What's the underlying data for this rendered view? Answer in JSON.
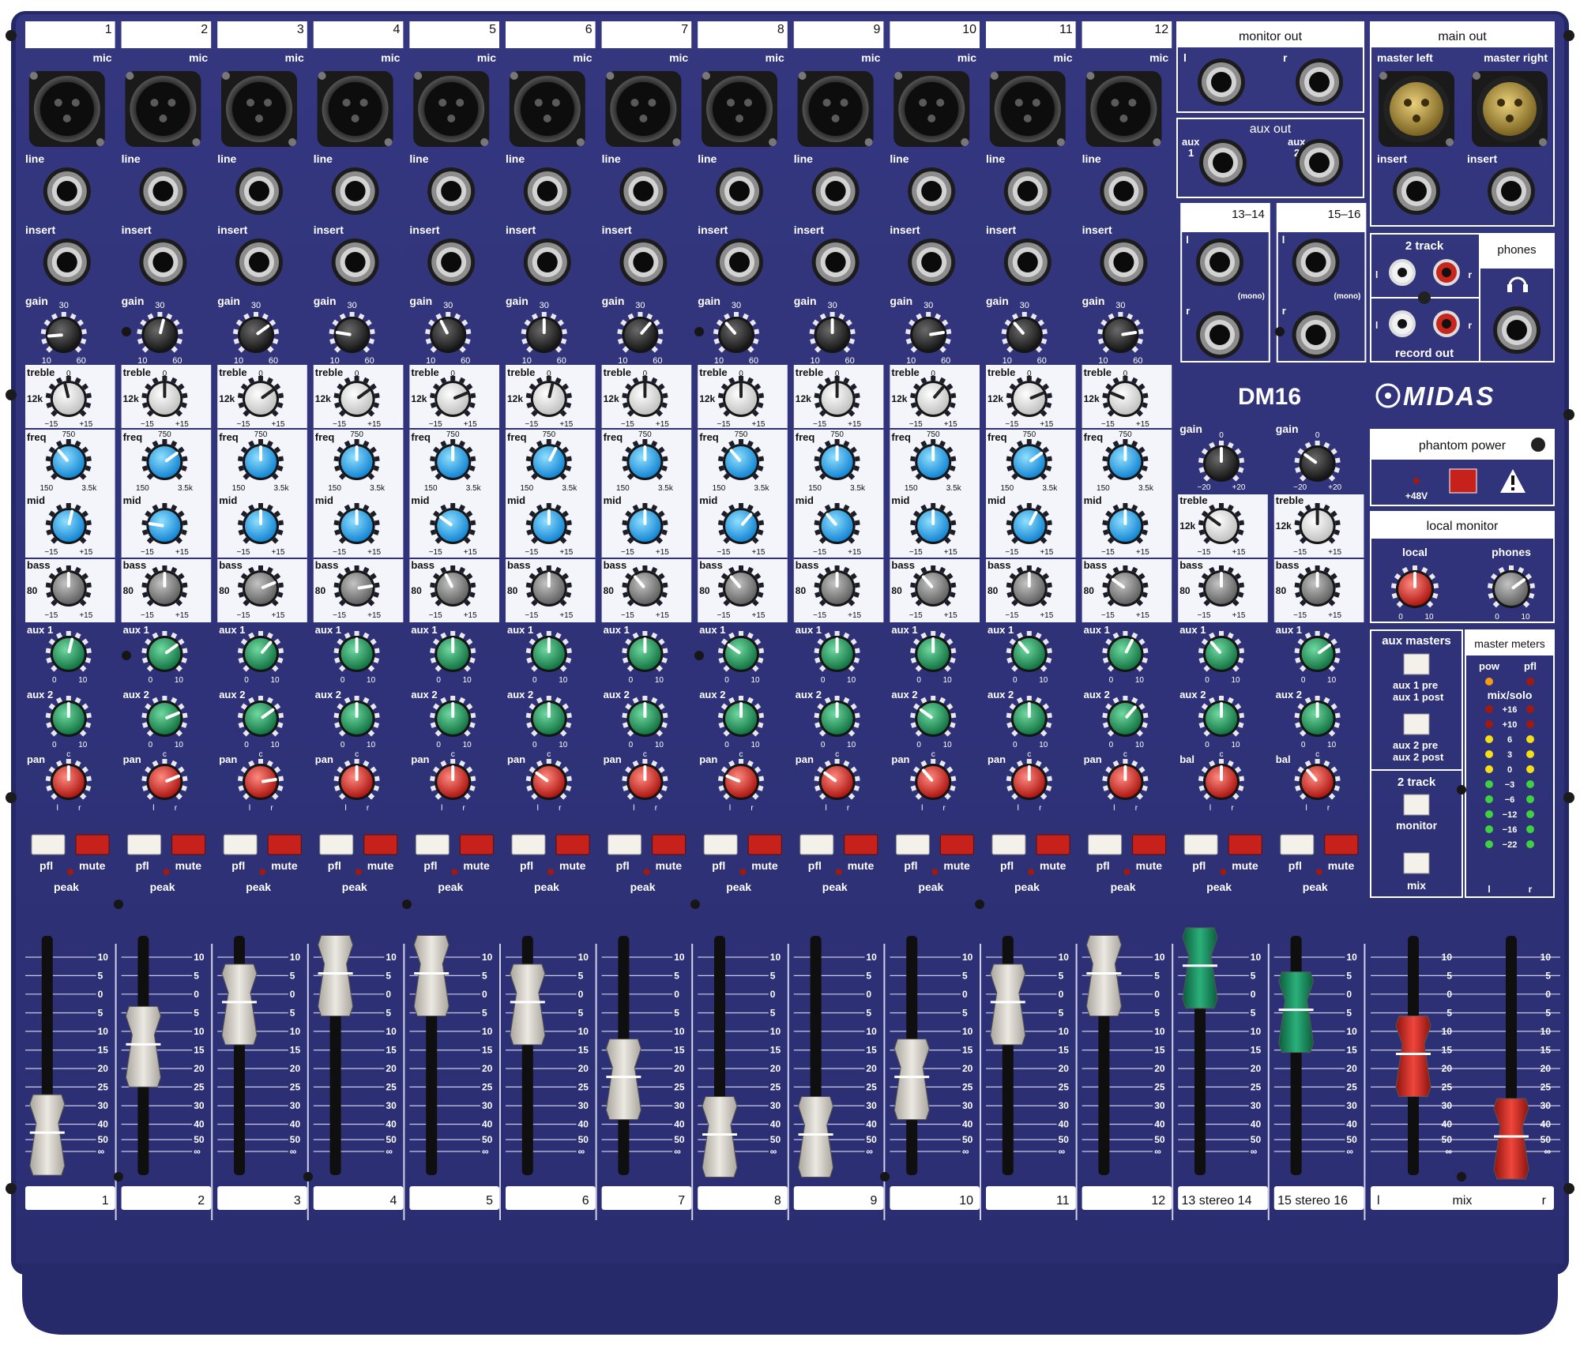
{
  "brand": "MIDAS",
  "model": "DM16",
  "colors": {
    "panel": "#2f3277",
    "panel_dark": "#1f2158",
    "panel_edge": "#252866",
    "white_band": "#eef0f6",
    "knob_dark": "#2a2a2a",
    "eq_white": "#f2f2f2",
    "eq_blue": "#2aa9f0",
    "eq_grey": "#8a8a8a",
    "aux_green": "#1e9b5c",
    "pan_red": "#d8221c",
    "pfl": "#f4f1ea",
    "mute": "#c7211b",
    "fader_grey": "#d9d6cf",
    "fader_green": "#15875a",
    "fader_red": "#c8281f",
    "led_green": "#3fd13f",
    "led_yellow": "#f3e018",
    "led_red": "#a11a10",
    "led_orange": "#f59a16"
  },
  "icons": {
    "xlr": "xlr-input-icon",
    "jack": "quarter-inch-jack-icon",
    "rca": "rca-jack-icon",
    "headphones": "headphones-icon",
    "warning": "warning-triangle-icon",
    "screw": "screw-icon",
    "logo": "midas-logo-icon"
  },
  "mono_channels": [
    {
      "number": "1",
      "gain": 0.15,
      "treble": 0.45,
      "freq": 0.35,
      "mid": 0.55,
      "bass": 0.5,
      "aux1": 0.55,
      "aux2": 0.5,
      "pan": 0.5,
      "fader": 0.91
    },
    {
      "number": "2",
      "gain": 0.55,
      "treble": 0.5,
      "freq": 0.7,
      "mid": 0.2,
      "bass": 0.5,
      "aux1": 0.7,
      "aux2": 0.75,
      "pan": 0.75,
      "fader": 0.45
    },
    {
      "number": "3",
      "gain": 0.7,
      "treble": 0.7,
      "freq": 0.5,
      "mid": 0.5,
      "bass": 0.75,
      "aux1": 0.65,
      "aux2": 0.7,
      "pan": 0.8,
      "fader": 0.23
    },
    {
      "number": "4",
      "gain": 0.2,
      "treble": 0.7,
      "freq": 0.5,
      "mid": 0.5,
      "bass": 0.8,
      "aux1": 0.5,
      "aux2": 0.5,
      "pan": 0.5,
      "fader": 0.08
    },
    {
      "number": "5",
      "gain": 0.4,
      "treble": 0.75,
      "freq": 0.5,
      "mid": 0.3,
      "bass": 0.4,
      "aux1": 0.5,
      "aux2": 0.5,
      "pan": 0.5,
      "fader": 0.08
    },
    {
      "number": "6",
      "gain": 0.5,
      "treble": 0.55,
      "freq": 0.6,
      "mid": 0.5,
      "bass": 0.5,
      "aux1": 0.5,
      "aux2": 0.5,
      "pan": 0.3,
      "fader": 0.23
    },
    {
      "number": "7",
      "gain": 0.65,
      "treble": 0.5,
      "freq": 0.5,
      "mid": 0.5,
      "bass": 0.35,
      "aux1": 0.5,
      "aux2": 0.5,
      "pan": 0.5,
      "fader": 0.62
    },
    {
      "number": "8",
      "gain": 0.35,
      "treble": 0.5,
      "freq": 0.35,
      "mid": 0.65,
      "bass": 0.35,
      "aux1": 0.3,
      "aux2": 0.5,
      "pan": 0.25,
      "fader": 0.92
    },
    {
      "number": "9",
      "gain": 0.5,
      "treble": 0.5,
      "freq": 0.5,
      "mid": 0.35,
      "bass": 0.5,
      "aux1": 0.5,
      "aux2": 0.5,
      "pan": 0.3,
      "fader": 0.92
    },
    {
      "number": "10",
      "gain": 0.8,
      "treble": 0.65,
      "freq": 0.5,
      "mid": 0.5,
      "bass": 0.35,
      "aux1": 0.5,
      "aux2": 0.3,
      "pan": 0.35,
      "fader": 0.62
    },
    {
      "number": "11",
      "gain": 0.35,
      "treble": 0.75,
      "freq": 0.7,
      "mid": 0.6,
      "bass": 0.5,
      "aux1": 0.35,
      "aux2": 0.5,
      "pan": 0.5,
      "fader": 0.23
    },
    {
      "number": "12",
      "gain": 0.8,
      "treble": 0.25,
      "freq": 0.5,
      "mid": 0.5,
      "bass": 0.3,
      "aux1": 0.6,
      "aux2": 0.65,
      "pan": 0.5,
      "fader": 0.08
    }
  ],
  "stereo_channels": [
    {
      "label": "13 stereo 14",
      "input_label": "13–14",
      "gain": 0.5,
      "treble": 0.3,
      "bass": 0.5,
      "aux1": 0.35,
      "aux2": 0.5,
      "bal": 0.5,
      "fader": 0.04
    },
    {
      "label": "15 stereo 16",
      "input_label": "15–16",
      "gain": 0.3,
      "treble": 0.5,
      "bass": 0.5,
      "aux1": 0.7,
      "aux2": 0.5,
      "bal": 0.35,
      "fader": 0.27
    }
  ],
  "mix_faders": {
    "left": 0.5,
    "right": 0.93
  },
  "labels": {
    "mic": "mic",
    "line": "line",
    "insert": "insert",
    "gain": "gain",
    "gain_min": "10",
    "gain_mid": "30",
    "gain_max": "60",
    "treble": "treble",
    "freq": "freq",
    "mid": "mid",
    "bass": "bass",
    "treble_freq": "12k",
    "bass_freq": "80",
    "freq_min": "150",
    "freq_mid": "750",
    "freq_max": "3.5k",
    "eq_min": "−15",
    "eq_mid": "0",
    "eq_max": "+15",
    "aux1": "aux 1",
    "aux2": "aux 2",
    "aux_min": "0",
    "aux_max": "10",
    "pan": "pan",
    "bal": "bal",
    "pan_c": "c",
    "pan_l": "l",
    "pan_r": "r",
    "pfl": "pfl",
    "mute": "mute",
    "peak": "peak",
    "stereo_gain_min": "−20",
    "stereo_gain_mid": "0",
    "stereo_gain_max": "+20",
    "mix": "mix",
    "fader_l": "l",
    "fader_r": "r"
  },
  "fader_scale": [
    "10",
    "5",
    "0",
    "5",
    "10",
    "15",
    "20",
    "25",
    "30",
    "40",
    "50",
    "∞"
  ],
  "outputs": {
    "monitor_out": "monitor out",
    "monitor_l": "l",
    "monitor_r": "r",
    "aux_out": "aux out",
    "aux_out_1": "aux\n1",
    "aux_out_2": "aux\n2",
    "mono_note": "(mono)",
    "ch_l": "l",
    "ch_r": "r",
    "main_out": "main out",
    "master_left": "master left",
    "master_right": "master right",
    "insert": "insert",
    "two_track": "2 track",
    "record_out": "record out",
    "phones": "phones"
  },
  "phantom": {
    "title": "phantom power",
    "indicator": "+48V"
  },
  "local_monitor": {
    "title": "local monitor",
    "local": "local",
    "phones": "phones",
    "min": "0",
    "max": "10",
    "local_level": 0.5,
    "phones_level": 0.7
  },
  "aux_masters": {
    "title": "aux masters",
    "aux1_pre": "aux 1 pre",
    "aux1_post": "aux 1 post",
    "aux2_pre": "aux 2 pre",
    "aux2_post": "aux 2 post",
    "two_track": "2 track",
    "monitor": "monitor",
    "mix": "mix"
  },
  "meters": {
    "title": "master meters",
    "pow": "pow",
    "pfl": "pfl",
    "mix_solo": "mix/solo",
    "levels": [
      "+16",
      "+10",
      "6",
      "3",
      "0",
      "−3",
      "−6",
      "−12",
      "−16",
      "−22"
    ],
    "left": "l",
    "right": "r"
  }
}
